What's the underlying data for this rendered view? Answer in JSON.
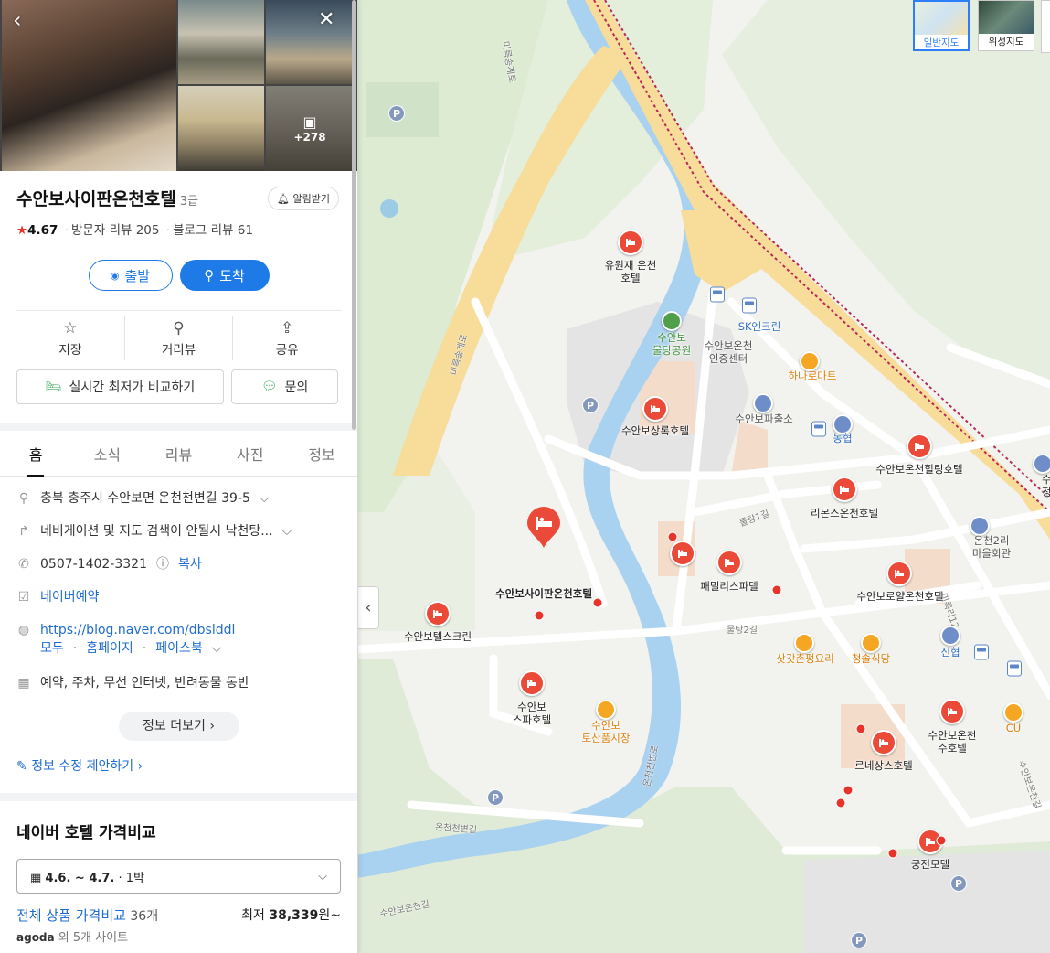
{
  "place": {
    "name": "수안보사이판온천호텔",
    "grade": "3급",
    "alarm_label": "알림받기",
    "rating": "4.67",
    "visitor_reviews": "방문자 리뷰 205",
    "blog_reviews": "블로그 리뷰 61",
    "photo_more": "+278"
  },
  "buttons": {
    "start": "출발",
    "arrive": "도착",
    "save": "저장",
    "street_view": "거리뷰",
    "share": "공유",
    "compare": "실시간 최저가 비교하기",
    "ask": "문의",
    "more_info": "정보 더보기",
    "edit_suggest": "정보 수정 제안하기"
  },
  "tabs": [
    "홈",
    "소식",
    "리뷰",
    "사진",
    "정보"
  ],
  "info": {
    "address": "충북 충주시 수안보면 온천천변길 39-5",
    "nav_note": "네비게이션 및 지도 검색이 안될시 낙천탕...",
    "phone": "0507-1402-3321",
    "copy": "복사",
    "booking": "네이버예약",
    "homepage_url": "https://blog.naver.com/dbslddl",
    "homepage_links": [
      "모두",
      "홈페이지",
      "페이스북"
    ],
    "amenities": "예약, 주차, 무선 인터넷, 반려동물 동반"
  },
  "hotel_price": {
    "title": "네이버 호텔 가격비교",
    "dates": "4.6. ~ 4.7.",
    "nights": "1박",
    "all_products": "전체 상품 가격비교",
    "count": "36개",
    "lowest_label": "최저",
    "lowest_price": "38,339",
    "currency": "원~",
    "site_logo": "agoda",
    "other_sites": "외 5개 사이트"
  },
  "map": {
    "type_normal": "일반지도",
    "type_satellite": "위성지도",
    "labels": {
      "yuwonjae": "유원재 온천\n호텔",
      "mulpark": "수안보\n물탕공원",
      "cert_center": "수안보온천\n인증센터",
      "sk": "SK엔크린",
      "hanaro": "하나로마트",
      "sangrok": "수안보상록호텔",
      "police": "수안보파출소",
      "nonghyup": "농협",
      "healing": "수안보온천힐링호텔",
      "lemons": "리몬스온천호텔",
      "family": "패밀리스파텔",
      "saipan": "수안보사이판온천호텔",
      "screen": "수안보텔스크린",
      "spa": "수안보\n스파호텔",
      "market": "수안보\n토산품시장",
      "satgat": "삿갓촌펑요리",
      "cheongsol": "청솔식당",
      "royal": "수안보로얄온천호텔",
      "village": "온천2리\n마을회관",
      "shinhyup": "신협",
      "cu": "CU",
      "suho": "수안보온천\n수호텔",
      "renaissance": "르네상스호텔",
      "gungjeon": "궁전모텔",
      "right_edge": "수안보 시\n정류소"
    },
    "roads": [
      "물탕1길",
      "물탕2길",
      "온천천변길",
      "수안보온천길",
      "미륵송계로",
      "미륵송계로",
      "온천천변로",
      "미륵리12",
      "수안보온천길"
    ]
  }
}
